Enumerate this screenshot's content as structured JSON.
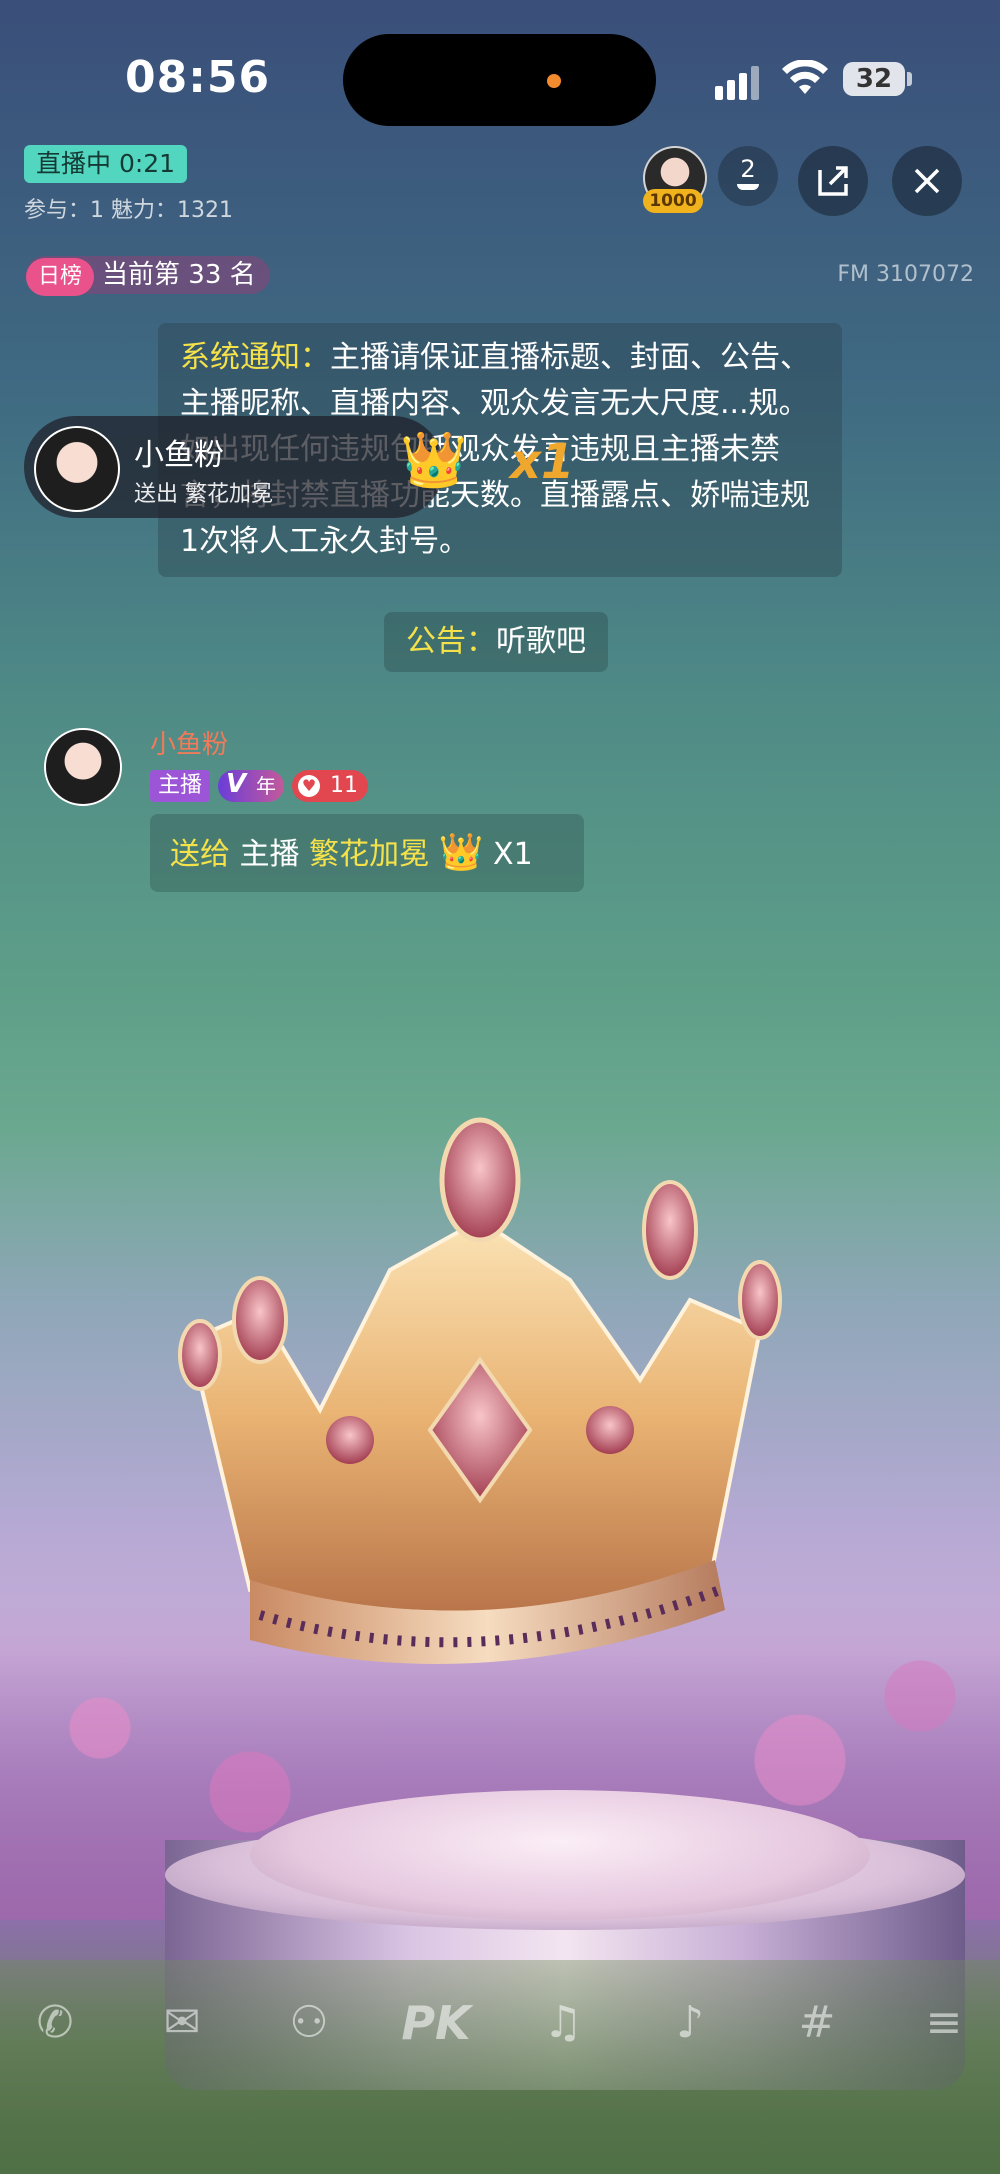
{
  "status_bar": {
    "time": "08:56",
    "battery": "32"
  },
  "live": {
    "badge": "直播中 0:21",
    "stats": "参与：1 魅力：1321",
    "host_badge": "1000",
    "viewer_count": "2"
  },
  "rank": {
    "tag": "日榜",
    "text": "当前第 33 名"
  },
  "fm_id": "FM 3107072",
  "system_notice": {
    "label": "系统通知：",
    "text": "主播请保证直播标题、封面、公告、主播昵称、直播内容、观众发言无大尺度...规。如出现任何违规包括观众发言违规且主播未禁言，将封禁直播功能天数。直播露点、娇喘违规1次将人工永久封号。"
  },
  "gift_banner": {
    "name": "小鱼粉",
    "line": "送出 繁花加冕",
    "count": "x1"
  },
  "announcement": {
    "label": "公告：",
    "text": "听歌吧"
  },
  "message": {
    "name": "小鱼粉",
    "role_tag": "主播",
    "vip_tag": "年",
    "fans_level": "11",
    "send_label": "送给",
    "recipient": "主播",
    "gift_name": "繁花加冕",
    "gift_count": "X1"
  },
  "toolbar": [
    {
      "name": "phone-icon",
      "glyph": "✆"
    },
    {
      "name": "mail-icon",
      "glyph": "✉"
    },
    {
      "name": "add-user-icon",
      "glyph": "⚇"
    },
    {
      "name": "pk-icon",
      "glyph": "PK"
    },
    {
      "name": "headphones-icon",
      "glyph": "♫"
    },
    {
      "name": "music-list-icon",
      "glyph": "♪"
    },
    {
      "name": "topic-icon",
      "glyph": "#"
    },
    {
      "name": "menu-icon",
      "glyph": "≡"
    }
  ]
}
